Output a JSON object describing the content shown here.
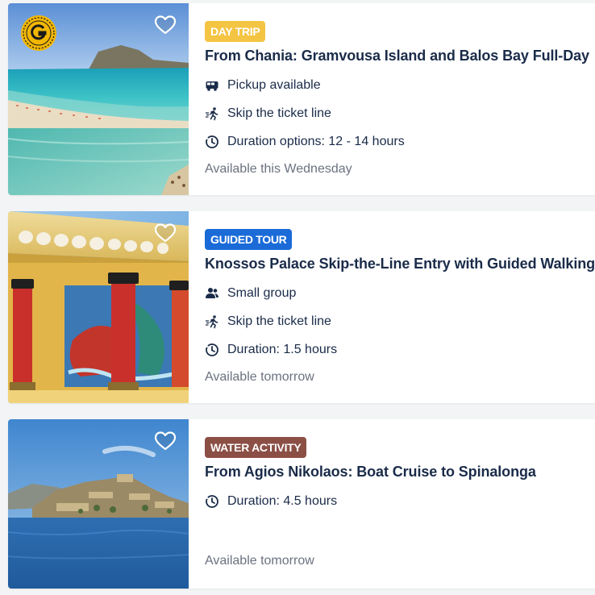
{
  "listings": [
    {
      "tag": "DAY TRIP",
      "title": "From Chania: Gramvousa Island and Balos Bay Full-Day",
      "features": [
        {
          "icon": "bus-icon",
          "text": "Pickup available"
        },
        {
          "icon": "skip-line-icon",
          "text": "Skip the ticket line"
        },
        {
          "icon": "clock-icon",
          "text": "Duration options: 12 - 14 hours"
        }
      ],
      "availability": "Available this Wednesday",
      "badge_letter": "G"
    },
    {
      "tag": "GUIDED TOUR",
      "title": "Knossos Palace Skip-the-Line Entry with Guided Walking",
      "features": [
        {
          "icon": "group-icon",
          "text": "Small group"
        },
        {
          "icon": "skip-line-icon",
          "text": "Skip the ticket line"
        },
        {
          "icon": "clock-icon",
          "text": "Duration: 1.5 hours"
        }
      ],
      "availability": "Available tomorrow"
    },
    {
      "tag": "WATER ACTIVITY",
      "title": "From Agios Nikolaos: Boat Cruise to Spinalonga",
      "features": [
        {
          "icon": "clock-icon",
          "text": "Duration: 4.5 hours"
        }
      ],
      "availability": "Available tomorrow"
    }
  ],
  "colors": {
    "day_trip_tag": "#f4c443",
    "guided_tour_tag": "#1a6bd8",
    "water_activity_tag": "#8b4f45",
    "title_text": "#1a2b49",
    "availability_text": "#6b7280",
    "badge_gold": "#f2b705"
  }
}
